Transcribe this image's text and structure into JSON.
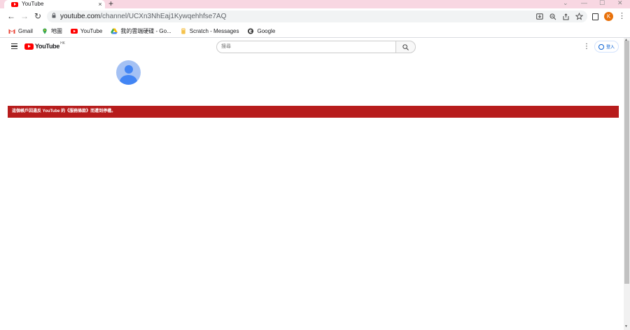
{
  "browser": {
    "tab": {
      "title": "YouTube",
      "close_glyph": "×"
    },
    "new_tab_glyph": "+",
    "window_controls": {
      "dropdown": "⌄",
      "minimize": "—",
      "maximize": "☐",
      "close": "✕"
    },
    "nav": {
      "back": "←",
      "forward": "→",
      "reload": "↻"
    },
    "omnibox": {
      "host": "youtube.com",
      "path": "/channel/UCXn3NhEaj1Kywqehhfse7AQ"
    },
    "omnibox_icons": [
      "install-icon",
      "zoom-icon",
      "share-icon",
      "bookmark-star-icon"
    ],
    "profile_initial": "K",
    "menu_glyph": "⋮",
    "bookmarks": [
      {
        "label": "Gmail",
        "icon": "gmail-icon"
      },
      {
        "label": "地圖",
        "icon": "maps-icon"
      },
      {
        "label": "YouTube",
        "icon": "youtube-icon"
      },
      {
        "label": "我的雲端硬碟 - Go...",
        "icon": "drive-icon"
      },
      {
        "label": "Scratch - Messages",
        "icon": "scratch-icon"
      },
      {
        "label": "Google",
        "icon": "google-icon"
      }
    ]
  },
  "youtube": {
    "logo_text": "YouTube",
    "region": "HK",
    "search": {
      "placeholder": "搜尋"
    },
    "more_glyph": "⋮",
    "signin_label": "登入",
    "alert_text": "這個帳戶因違反 YouTube 的《服務條款》而遭到停權。"
  },
  "colors": {
    "tabstrip": "#f8d7e2",
    "alert": "#b71c1c",
    "youtube_red": "#ff0000",
    "avatar": "#e8710a",
    "link_blue": "#065fd4"
  }
}
